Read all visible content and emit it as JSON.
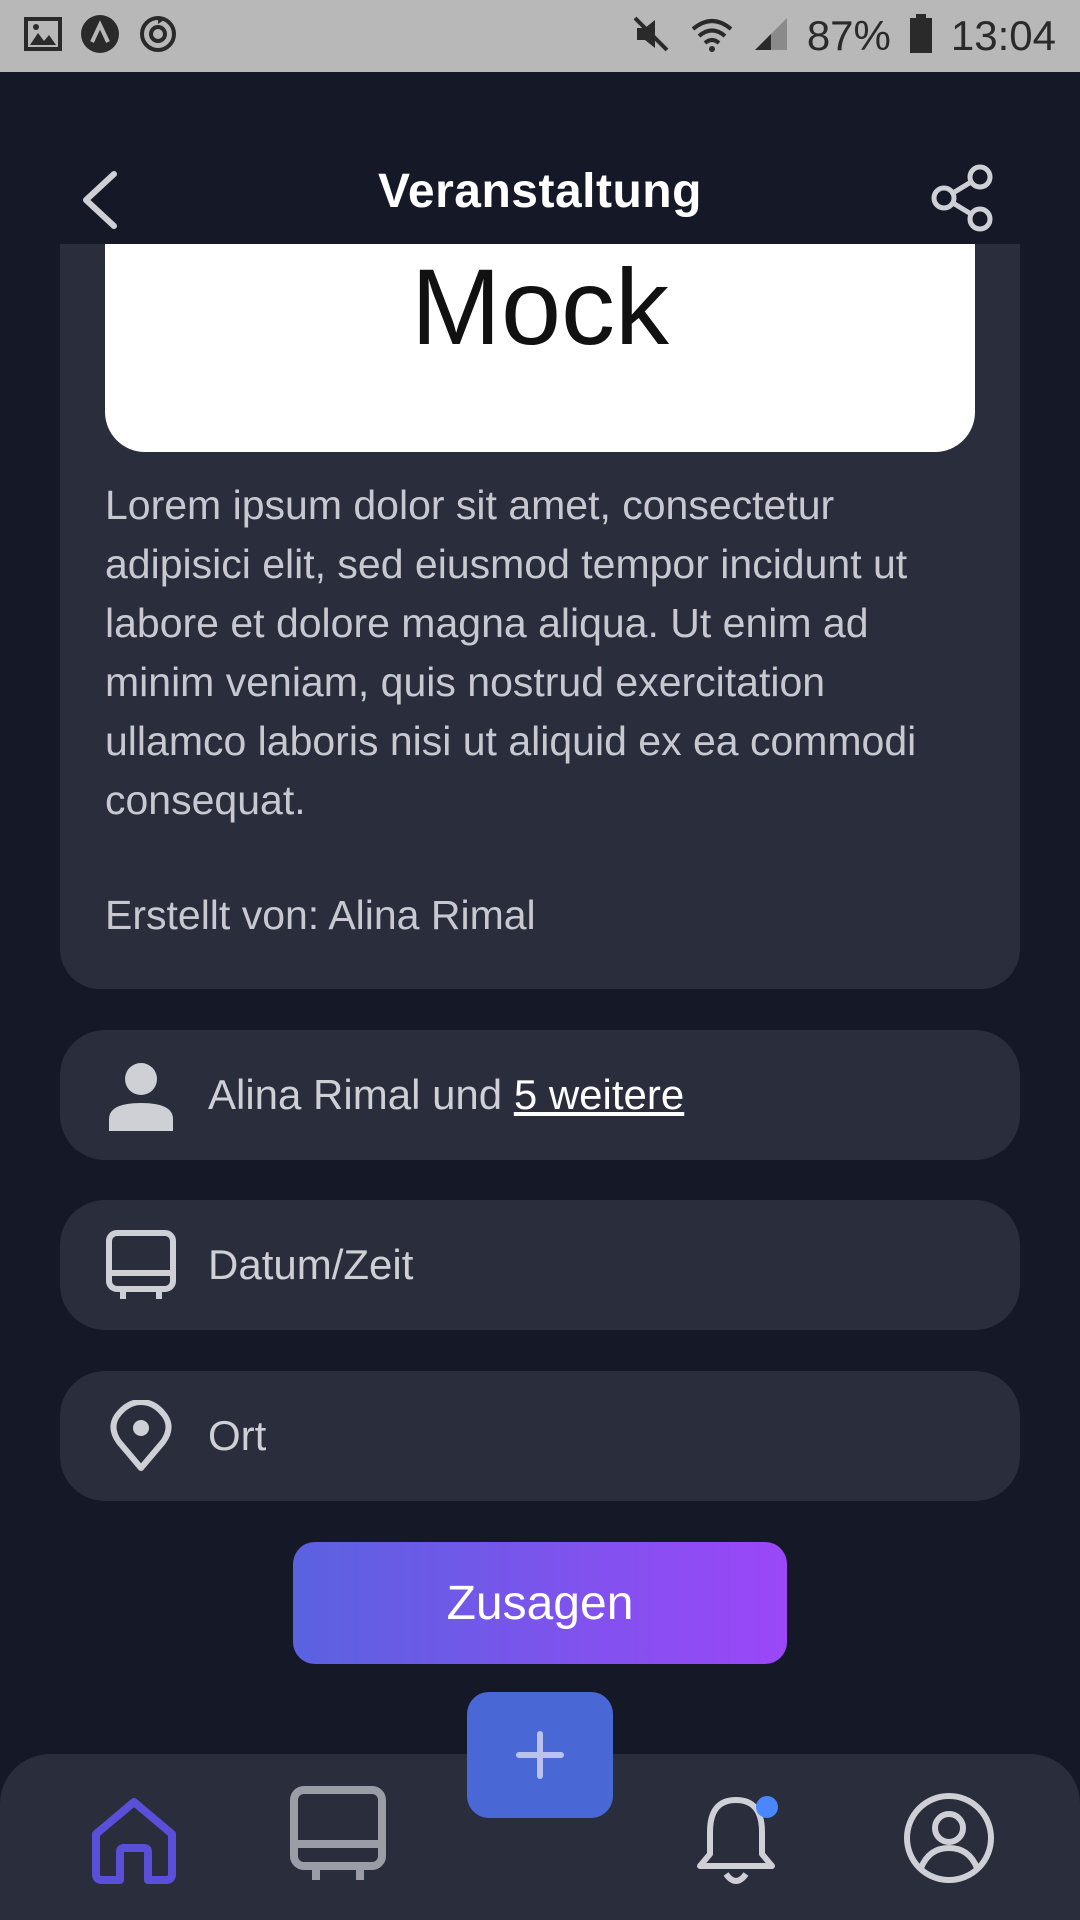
{
  "status_bar": {
    "battery": "87%",
    "time": "13:04"
  },
  "header": {
    "title": "Veranstaltung"
  },
  "event": {
    "image_text": "Mock",
    "description": "Lorem ipsum dolor sit amet, consectetur adipisici elit, sed eiusmod tempor incidunt ut labore et dolore magna aliqua. Ut enim ad minim veniam, quis nostrud exercitation ullamco laboris nisi ut aliquid ex ea commodi consequat.",
    "creator": "Erstellt von: Alina Rimal"
  },
  "attendees": {
    "prefix": "Alina Rimal und ",
    "more_link": "5 weitere"
  },
  "datetime": {
    "label": "Datum/Zeit"
  },
  "location": {
    "label": "Ort"
  },
  "accept_button": {
    "label": "Zusagen"
  },
  "colors": {
    "background": "#151826",
    "card": "#2a2d3c",
    "button_gradient_start": "#5a62e0",
    "button_gradient_end": "#9b47f8",
    "fab": "#4a67d6",
    "nav_active": "#5a4fd8"
  },
  "nav": {
    "items": [
      "home-icon",
      "calendar-icon",
      "add-icon",
      "bell-icon",
      "profile-icon"
    ],
    "active": "home-icon"
  }
}
